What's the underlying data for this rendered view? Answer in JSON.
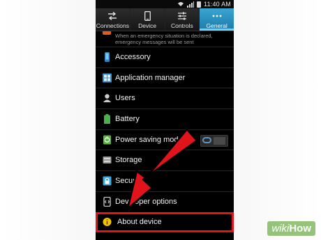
{
  "status_bar": {
    "time": "11:40 AM"
  },
  "tabs": [
    {
      "label": "Connections",
      "icon": "swap-arrows-icon",
      "active": false
    },
    {
      "label": "Device",
      "icon": "phone-icon",
      "active": false
    },
    {
      "label": "Controls",
      "icon": "sliders-icon",
      "active": false
    },
    {
      "label": "General",
      "icon": "more-dots-icon",
      "active": true
    }
  ],
  "notice_text": "When an emergency situation is declared, emergency messages will be sent",
  "settings": [
    {
      "label": "Accessory",
      "icon": "accessory-icon",
      "icon_color": "#2e86c1"
    },
    {
      "label": "Application manager",
      "icon": "app-grid-icon",
      "icon_color": "#3a8fd0"
    },
    {
      "label": "Users",
      "icon": "user-icon",
      "icon_color": "#cccccc"
    },
    {
      "label": "Battery",
      "icon": "battery-icon",
      "icon_color": "#4caf50"
    },
    {
      "label": "Power saving mode",
      "icon": "power-saving-icon",
      "icon_color": "#5fb04a",
      "toggle": true
    },
    {
      "label": "Storage",
      "icon": "storage-icon",
      "icon_color": "#999999"
    },
    {
      "label": "Security",
      "icon": "lock-icon",
      "icon_color": "#3ea8e0"
    },
    {
      "label": "Developer options",
      "icon": "developer-icon",
      "icon_color": "#cccccc"
    },
    {
      "label": "About device",
      "icon": "info-icon",
      "icon_color": "#f2c200",
      "highlighted": true
    }
  ],
  "annotation": {
    "arrow_color": "#e0141a",
    "highlight_color": "#e0141a"
  },
  "watermark": {
    "wiki": "wiki",
    "how": "How"
  }
}
